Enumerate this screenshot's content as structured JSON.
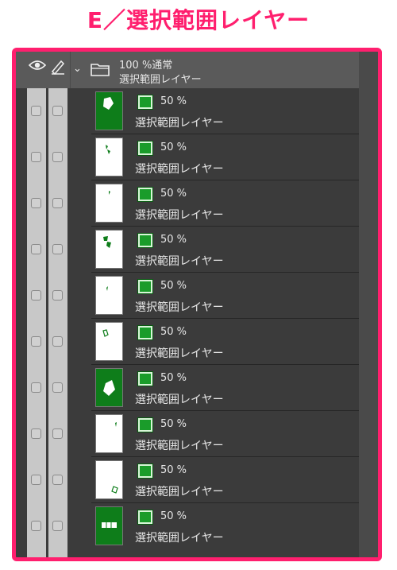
{
  "title": "E／選択範囲レイヤー",
  "header": {
    "folder_blend": "100 %通常",
    "folder_name": "選択範囲レイヤー"
  },
  "icons": {
    "eye": "eye-icon",
    "pen": "pen-icon",
    "chevron": "chevron-down-icon",
    "folder": "folder-icon",
    "mask": "selection-mask-icon"
  },
  "colors": {
    "accent": "#ff1f6e",
    "panel": "#3b3b3b",
    "selection_green": "#0e7d1a"
  },
  "layers": [
    {
      "opacity": "50 %",
      "name": "選択範囲レイヤー",
      "thumb": "green-full"
    },
    {
      "opacity": "50 %",
      "name": "選択範囲レイヤー",
      "thumb": "white"
    },
    {
      "opacity": "50 %",
      "name": "選択範囲レイヤー",
      "thumb": "white"
    },
    {
      "opacity": "50 %",
      "name": "選択範囲レイヤー",
      "thumb": "white"
    },
    {
      "opacity": "50 %",
      "name": "選択範囲レイヤー",
      "thumb": "white"
    },
    {
      "opacity": "50 %",
      "name": "選択範囲レイヤー",
      "thumb": "white"
    },
    {
      "opacity": "50 %",
      "name": "選択範囲レイヤー",
      "thumb": "green-full"
    },
    {
      "opacity": "50 %",
      "name": "選択範囲レイヤー",
      "thumb": "white"
    },
    {
      "opacity": "50 %",
      "name": "選択範囲レイヤー",
      "thumb": "white"
    },
    {
      "opacity": "50 %",
      "name": "選択範囲レイヤー",
      "thumb": "green-full"
    }
  ]
}
